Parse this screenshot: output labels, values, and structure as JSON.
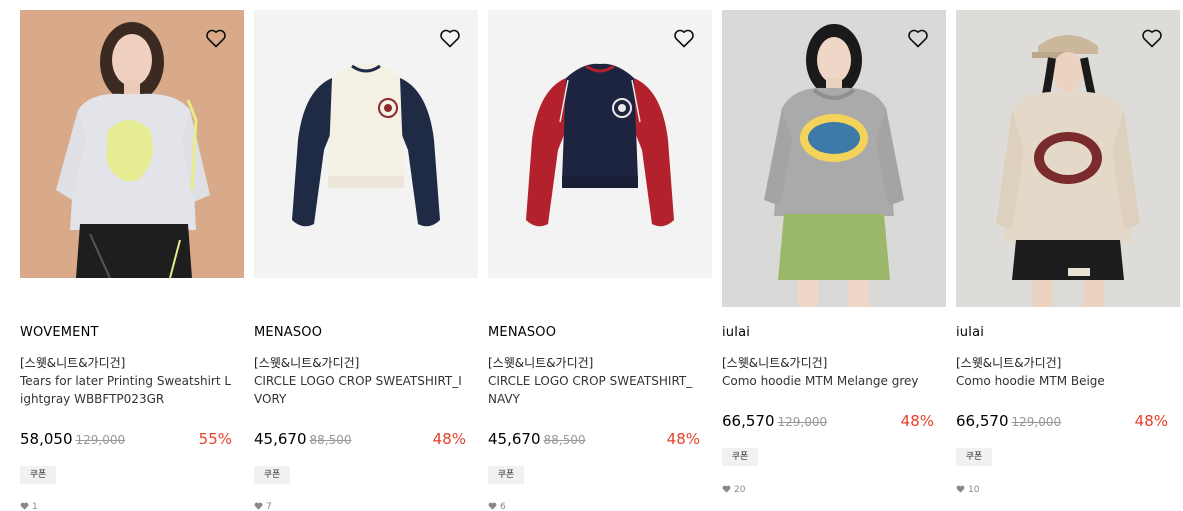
{
  "products": [
    {
      "brand": "WOVEMENT",
      "category": "[스웻&니트&가디건]",
      "name": "Tears for later Printing Sweatshirt Lightgray WBBFTP023GR",
      "sale_price": "58,050",
      "original_price": "129,000",
      "discount": "55%",
      "coupon": "쿠폰",
      "likes": "1",
      "image": "woman-in-lightgray-sweatshirt"
    },
    {
      "brand": "MENASOO",
      "category": "[스웻&니트&가디건]",
      "name": "CIRCLE LOGO CROP SWEATSHIRT_IVORY",
      "sale_price": "45,670",
      "original_price": "88,500",
      "discount": "48%",
      "coupon": "쿠폰",
      "likes": "7",
      "image": "ivory-navy-raglan-sweatshirt"
    },
    {
      "brand": "MENASOO",
      "category": "[스웻&니트&가디건]",
      "name": "CIRCLE LOGO CROP SWEATSHIRT_NAVY",
      "sale_price": "45,670",
      "original_price": "88,500",
      "discount": "48%",
      "coupon": "쿠폰",
      "likes": "6",
      "image": "navy-red-raglan-sweatshirt"
    },
    {
      "brand": "iulai",
      "category": "[스웻&니트&가디건]",
      "name": "Como hoodie MTM Melange grey",
      "sale_price": "66,570",
      "original_price": "129,000",
      "discount": "48%",
      "coupon": "쿠폰",
      "likes": "20",
      "image": "woman-in-grey-hoodie"
    },
    {
      "brand": "iulai",
      "category": "[스웻&니트&가디건]",
      "name": "Como hoodie MTM Beige",
      "sale_price": "66,570",
      "original_price": "129,000",
      "discount": "48%",
      "coupon": "쿠폰",
      "likes": "10",
      "image": "woman-in-beige-hoodie"
    }
  ],
  "colors": {
    "discount": "#e8402b",
    "coupon_bg": "#f1f1f1"
  }
}
